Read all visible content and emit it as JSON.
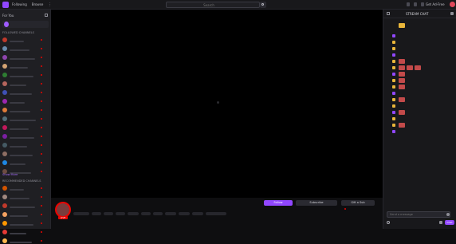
{
  "topbar": {
    "nav_following": "Following",
    "nav_browse": "Browse",
    "nav_more": "⋮",
    "search_placeholder": "Search",
    "get_ad_free": "Get Ad-Free",
    "colors": {
      "brand": "#9147ff",
      "live": "#eb0400"
    }
  },
  "sidebar": {
    "heading": "For You",
    "promo_text": "",
    "section_followed": "FOLLOWED CHANNELS",
    "section_recommended": "RECOMMENDED CHANNELS",
    "show_more": "Show More",
    "followed": [
      {
        "name": "",
        "count": "",
        "color": "#c0392b"
      },
      {
        "name": "",
        "count": "",
        "color": "#6a8caf"
      },
      {
        "name": "",
        "count": "",
        "color": "#8e44ad"
      },
      {
        "name": "",
        "count": "",
        "color": "#d4a373"
      },
      {
        "name": "",
        "count": "",
        "color": "#2e7d32"
      },
      {
        "name": "",
        "count": "",
        "color": "#b5655d"
      },
      {
        "name": "",
        "count": "",
        "color": "#3f51b5"
      },
      {
        "name": "",
        "count": "",
        "color": "#9c27b0"
      },
      {
        "name": "",
        "count": "",
        "color": "#e07b39"
      },
      {
        "name": "",
        "count": "",
        "color": "#546e7a"
      },
      {
        "name": "",
        "count": "",
        "color": "#c2185b"
      },
      {
        "name": "",
        "count": "",
        "color": "#7b1fa2"
      },
      {
        "name": "",
        "count": "",
        "color": "#455a64"
      },
      {
        "name": "",
        "count": "",
        "color": "#8d6e63"
      },
      {
        "name": "",
        "count": "",
        "color": "#1e88e5"
      },
      {
        "name": "",
        "count": "",
        "color": "#6d4c41"
      }
    ],
    "recommended": [
      {
        "name": "",
        "count": "",
        "color": "#d35400"
      },
      {
        "name": "",
        "count": "",
        "color": "#a1887f"
      },
      {
        "name": "",
        "count": "",
        "color": "#c0392b"
      },
      {
        "name": "",
        "count": "",
        "color": "#f4a261"
      },
      {
        "name": "",
        "count": "",
        "color": "#ff9800"
      },
      {
        "name": "",
        "count": "",
        "color": "#e53935"
      },
      {
        "name": "",
        "count": "",
        "color": "#ffb74d"
      }
    ]
  },
  "stream": {
    "channel_name": "",
    "title": "",
    "live_label": "LIVE",
    "follow_label": "Follow",
    "subscribe_label": "Subscribe",
    "gift_label": "Gift a Sub",
    "viewers": "",
    "uptime": "",
    "about_label": "",
    "panels_label": ""
  },
  "chat": {
    "header": "STREAM CHAT",
    "leaderboard_title": "",
    "leaderboard_users": [
      "",
      ""
    ],
    "input_placeholder": "Send a message",
    "points": "",
    "send_label": "Chat",
    "messages": [
      {
        "user": "",
        "color": "#ff7f50",
        "text": "",
        "emotes": 0
      },
      {
        "user": "",
        "color": "#1e90ff",
        "text": "",
        "emotes": 0
      },
      {
        "user": "",
        "color": "#9acd32",
        "text": "",
        "emotes": 0
      },
      {
        "user": "",
        "color": "#ff69b4",
        "text": "",
        "emotes": 0
      },
      {
        "user": "",
        "color": "#daa520",
        "text": "",
        "emotes": 1
      },
      {
        "user": "",
        "color": "#b22222",
        "text": "",
        "emotes": 3
      },
      {
        "user": "",
        "color": "#00ff7f",
        "text": "",
        "emotes": 1
      },
      {
        "user": "",
        "color": "#8a2be2",
        "text": "",
        "emotes": 1
      },
      {
        "user": "",
        "color": "#ff4500",
        "text": "",
        "emotes": 1
      },
      {
        "user": "",
        "color": "#5f9ea0",
        "text": "",
        "emotes": 0
      },
      {
        "user": "",
        "color": "#d2691e",
        "text": "",
        "emotes": 1
      },
      {
        "user": "",
        "color": "#2e8b57",
        "text": "",
        "emotes": 0
      },
      {
        "user": "",
        "color": "#c71585",
        "text": "",
        "emotes": 1
      },
      {
        "user": "",
        "color": "#4169e1",
        "text": "",
        "emotes": 0
      },
      {
        "user": "",
        "color": "#ff6347",
        "text": "",
        "emotes": 1
      },
      {
        "user": "",
        "color": "#9370db",
        "text": "",
        "emotes": 0
      }
    ]
  }
}
